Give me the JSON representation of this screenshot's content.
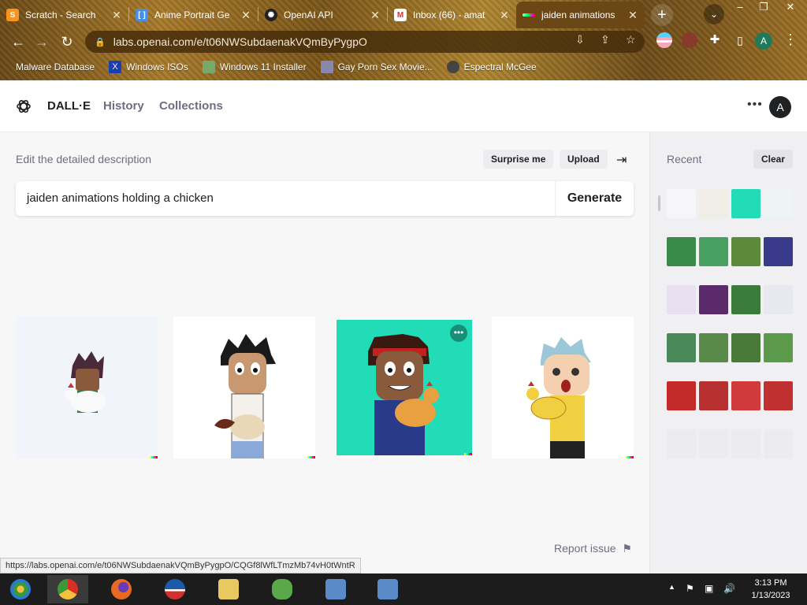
{
  "browser": {
    "tabs": [
      {
        "title": "Scratch - Search",
        "favicon": "scratch-icon",
        "color": "#f7931e"
      },
      {
        "title": "Anime Portrait Ge",
        "favicon": "bracket-icon",
        "color": "#4a90e2"
      },
      {
        "title": "OpenAI API",
        "favicon": "openai-icon",
        "color": "#222222"
      },
      {
        "title": "Inbox (66) - amat",
        "favicon": "gmail-icon",
        "color": "#d93025"
      },
      {
        "title": "jaiden animations",
        "favicon": "dalle-icon",
        "color": "#ffffff"
      }
    ],
    "new_tab": "+",
    "url": "labs.openai.com/e/t06NWSubdaenakVQmByPygpO",
    "bookmarks": [
      {
        "label": "Malware Database",
        "icon": "folder-icon",
        "color": "#d8b45a"
      },
      {
        "label": "Windows ISOs",
        "icon": "x-icon",
        "color": "#1a3fb0"
      },
      {
        "label": "Windows 11 Installer",
        "icon": "image-icon",
        "color": "#7aa86a"
      },
      {
        "label": "Gay Porn Sex Movie...",
        "icon": "cube-icon",
        "color": "#8888aa"
      },
      {
        "label": "Espectral McGee",
        "icon": "avatar-icon",
        "color": "#444444"
      }
    ],
    "profile_initial": "A",
    "status_url": "https://labs.openai.com/e/t06NWSubdaenakVQmByPygpO/CQGf8lWfLTmzMb74vH0tWntR"
  },
  "app": {
    "brand": "DALL·E",
    "nav": [
      "History",
      "Collections"
    ],
    "avatar_initial": "A",
    "prompt_label": "Edit the detailed description",
    "surprise_label": "Surprise me",
    "upload_label": "Upload",
    "prompt_value": "jaiden animations holding a chicken",
    "generate_label": "Generate",
    "report_label": "Report issue",
    "recent_label": "Recent",
    "clear_label": "Clear"
  },
  "results": [
    {
      "bg": "#f2f4fb",
      "skin": "#8a5a3c",
      "hair": "#4a2a3a",
      "shirt": "#2d7a3a",
      "selected": false
    },
    {
      "bg": "#ffffff",
      "skin": "#c89870",
      "hair": "#1a1a1a",
      "shirt": "#f4f0ea",
      "selected": false
    },
    {
      "bg": "#22dcb8",
      "skin": "#8a5a3c",
      "hair": "#3a1a10",
      "shirt": "#2a3a8a",
      "selected": true
    },
    {
      "bg": "#ffffff",
      "skin": "#f4d0b0",
      "hair": "#9ac8d8",
      "shirt": "#f0d040",
      "selected": false
    }
  ],
  "recent_thumbs": [
    [
      "#f6f6fa",
      "#f0ece6",
      "#22dcb8",
      "#eef4f4"
    ],
    [
      "#3a8a4a",
      "#48a060",
      "#5a8a3a",
      "#3a3a8a"
    ],
    [
      "#e8e0f0",
      "#5a2a6a",
      "#3a7a3a",
      "#e8e8f0"
    ],
    [
      "#4a8a5a",
      "#5a8a4a",
      "#4a7a3a",
      "#5a9a4a"
    ],
    [
      "#c42a2a",
      "#b83030",
      "#d03a3a",
      "#c03030"
    ],
    [
      "#ececf0",
      "#ececf0",
      "#ececf0",
      "#ececf0"
    ]
  ],
  "taskbar": {
    "apps": [
      {
        "name": "win7-start-icon",
        "color": "#2a7ad0"
      },
      {
        "name": "chrome-icon",
        "color": "#e8b020"
      },
      {
        "name": "firefox-icon",
        "color": "#e86a20"
      },
      {
        "name": "obama-logo-icon",
        "color": "#1a5aa8"
      },
      {
        "name": "explorer-icon",
        "color": "#e8c860"
      },
      {
        "name": "network-people-icon",
        "color": "#5aa84a"
      },
      {
        "name": "network-computer-icon",
        "color": "#5a8ac8"
      },
      {
        "name": "network-computer-icon-2",
        "color": "#5a8ac8"
      }
    ],
    "time": "3:13 PM",
    "date": "1/13/2023"
  }
}
